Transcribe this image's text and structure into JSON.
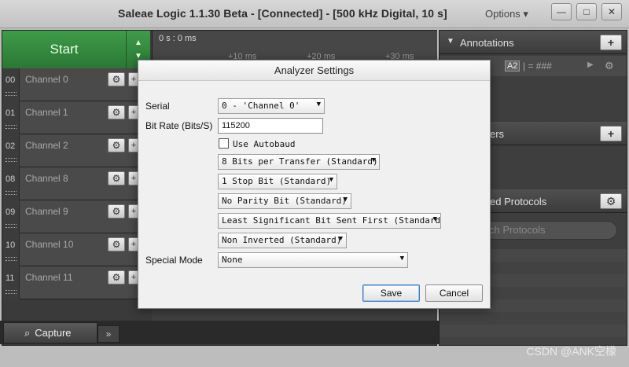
{
  "window": {
    "title": "Saleae Logic 1.1.30 Beta - [Connected] - [500 kHz Digital, 10 s]",
    "options_label": "Options ▾"
  },
  "toolbar": {
    "start_label": "Start"
  },
  "timeline": {
    "origin": "0 s : 0 ms",
    "ticks": [
      "+10 ms",
      "+20 ms",
      "+30 ms"
    ]
  },
  "channels": [
    {
      "num": "00",
      "name": "Channel 0"
    },
    {
      "num": "01",
      "name": "Channel 1"
    },
    {
      "num": "02",
      "name": "Channel 2"
    },
    {
      "num": "08",
      "name": "Channel 8"
    },
    {
      "num": "09",
      "name": "Channel 9"
    },
    {
      "num": "10",
      "name": "Channel 10"
    },
    {
      "num": "11",
      "name": "Channel 11"
    }
  ],
  "bottom_tabs": {
    "capture_label": "Capture",
    "more_label": "»"
  },
  "right_panel": {
    "annotations_label": "Annotations",
    "annotation_row": {
      "marker": "A2",
      "text": "| = ###"
    },
    "analyzers_label": "ers",
    "protocols_label": "ed Protocols",
    "search_placeholder": "ch Protocols"
  },
  "dialog": {
    "title": "Analyzer Settings",
    "serial_label": "Serial",
    "serial_value": "0 - 'Channel 0'",
    "bitrate_label": "Bit Rate (Bits/S)",
    "bitrate_value": "115200",
    "autobaud_label": "Use Autobaud",
    "autobaud_checked": false,
    "bits_per_transfer": "8 Bits per Transfer (Standard)",
    "stop_bits": "1 Stop Bit (Standard)",
    "parity": "No Parity Bit (Standard)",
    "bit_order": "Least Significant Bit Sent First (Standard)",
    "inversion": "Non Inverted (Standard)",
    "special_mode_label": "Special Mode",
    "special_mode_value": "None",
    "save_label": "Save",
    "cancel_label": "Cancel"
  },
  "watermark": "CSDN @ANK空檬"
}
